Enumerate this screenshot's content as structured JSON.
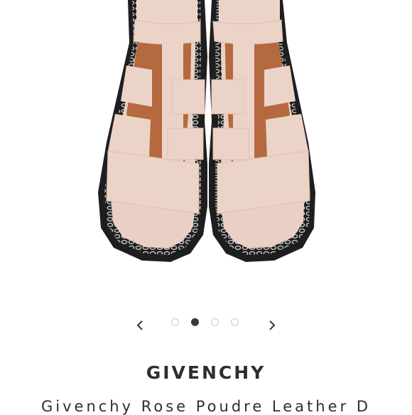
{
  "carousel": {
    "prev_icon": "chevron-left-icon",
    "next_icon": "chevron-right-icon",
    "slide_count": 4,
    "active_slide": 2
  },
  "product": {
    "brand": "GIVENCHY",
    "title": "Givenchy Rose Poudre Leather D"
  },
  "colors": {
    "leather": "#ecd3c8",
    "lining": "#b56b43",
    "chain": "#9a9a9a",
    "sole": "#222222",
    "active_dot": "#3a3a3a"
  }
}
